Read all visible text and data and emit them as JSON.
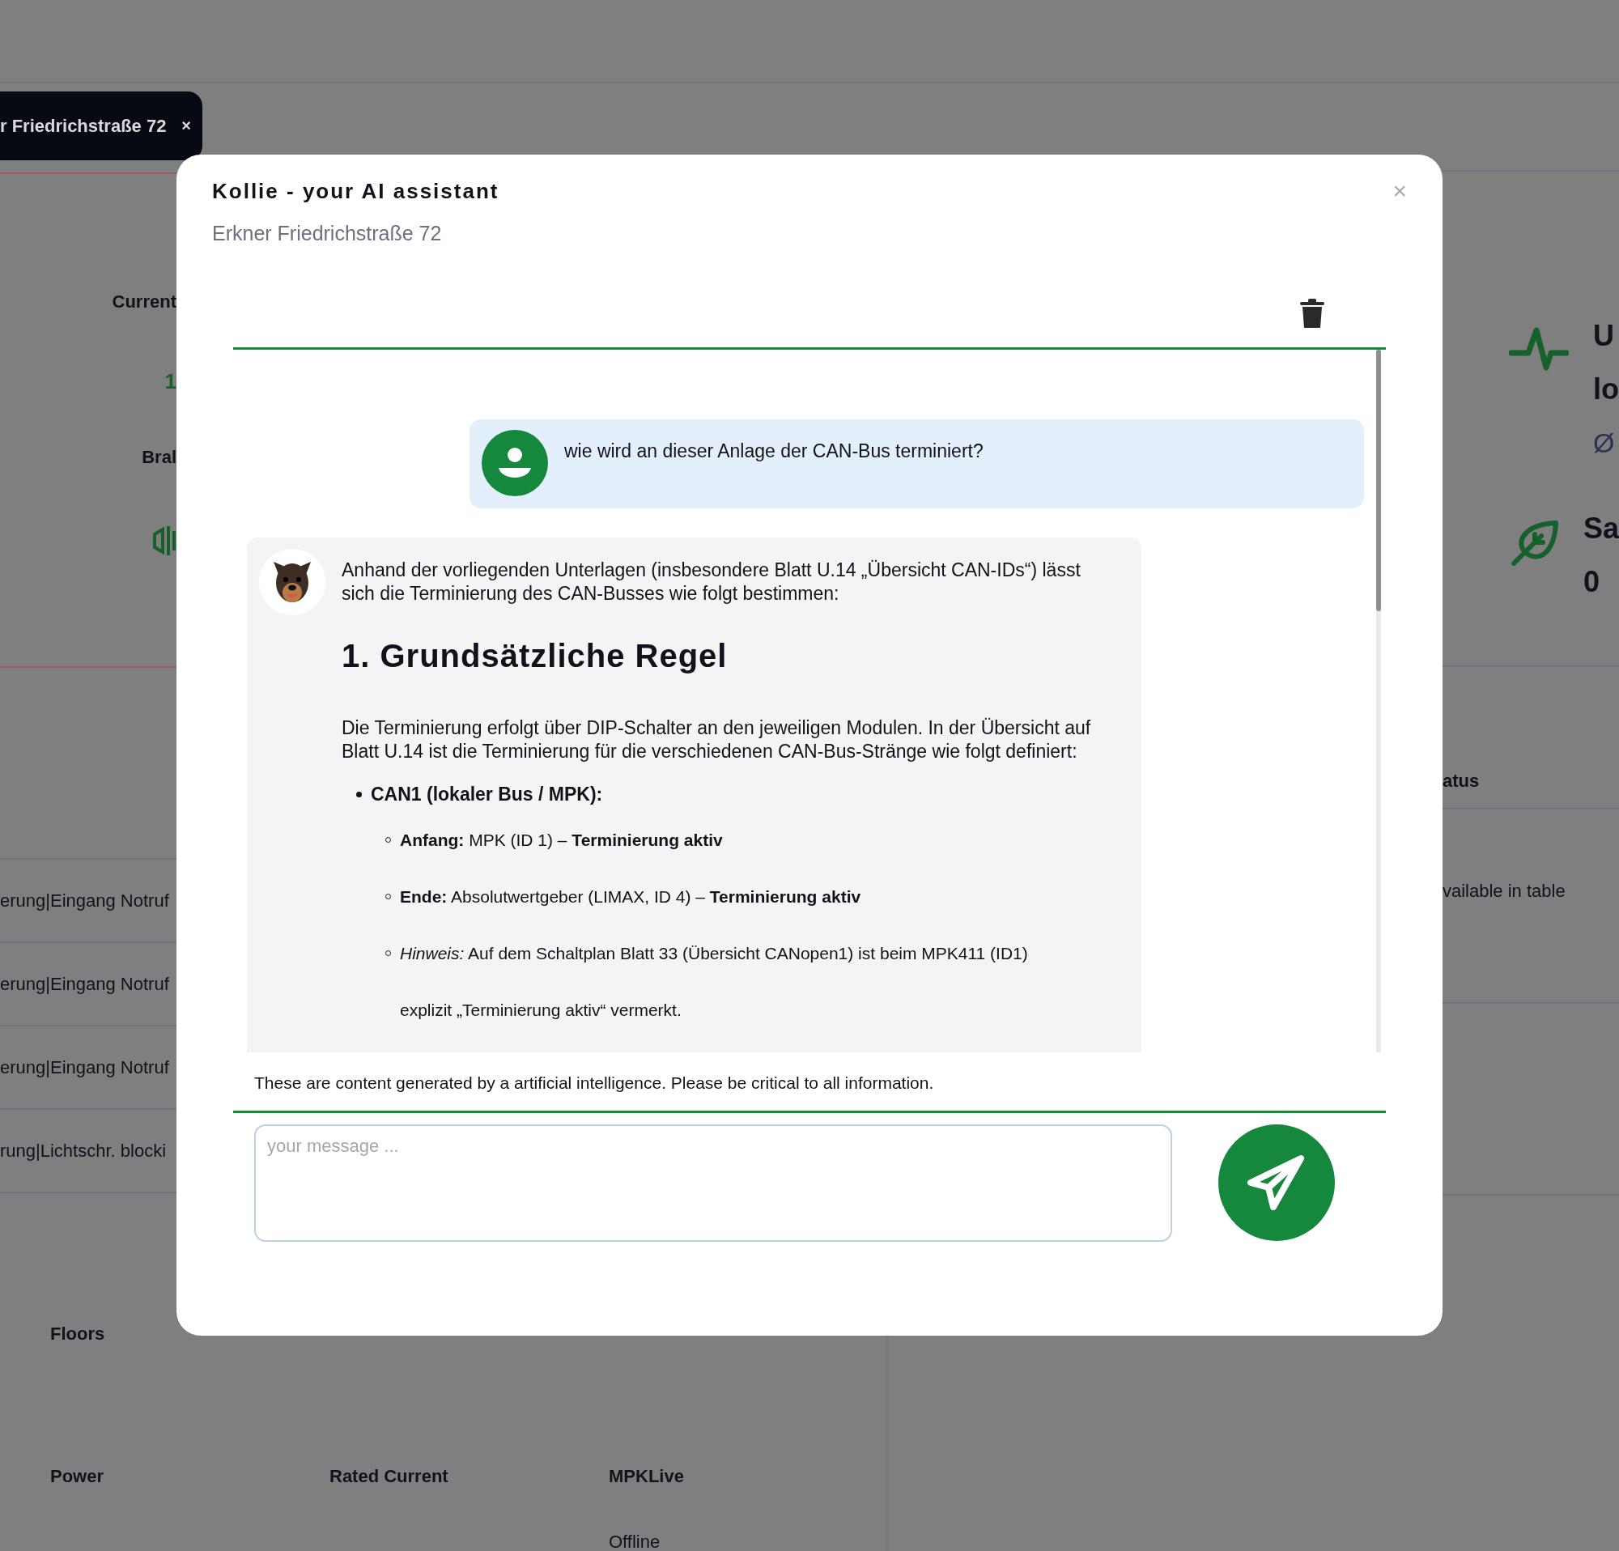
{
  "background": {
    "tab": {
      "label": "r Friedrichstraße 72",
      "close": "×"
    },
    "left_stats": [
      {
        "kind": "value",
        "label": "Current",
        "value": "1"
      },
      {
        "kind": "icon",
        "label": "Bral"
      }
    ],
    "event_rows": [
      "erung|Eingang Notruf",
      "erung|Eingang Notruf",
      "erung|Eingang Notruf",
      "rung|Lichtschr. blocki"
    ],
    "right_stats": [
      {
        "kind": "activity",
        "lines": [
          "U",
          "lo"
        ],
        "sub": "Ø"
      },
      {
        "kind": "leaf",
        "lines": [
          "Sa",
          "0"
        ]
      }
    ],
    "status_table": {
      "heading": "atus",
      "empty_text": "vailable in table"
    },
    "field_rows": [
      [
        {
          "label": "Floors"
        }
      ],
      [
        {
          "label": "Power"
        },
        {
          "label": "Rated Current"
        },
        {
          "label": "MPKLive",
          "value": "Offline"
        }
      ]
    ]
  },
  "dialog": {
    "title": "Kollie - your AI assistant",
    "subtitle": "Erkner Friedrichstraße 72",
    "close": "×",
    "messages": [
      {
        "kind": "user",
        "text": "wie wird an dieser Anlage der CAN-Bus terminiert?"
      },
      {
        "kind": "assistant",
        "blocks": [
          {
            "kind": "paragraph",
            "text": "Anhand der vorliegenden Unterlagen (insbesondere Blatt U.14 „Übersicht CAN-IDs“) lässt sich die Terminierung des CAN-Busses wie folgt bestimmen:"
          },
          {
            "kind": "heading",
            "text": "1. Grundsätzliche Regel"
          },
          {
            "kind": "paragraph",
            "text": "Die Terminierung erfolgt über DIP-Schalter an den jeweiligen Modulen. In der Übersicht auf Blatt U.14 ist die Terminierung für die verschiedenen CAN-Bus-Stränge wie folgt definiert:"
          },
          {
            "kind": "list",
            "items": [
              {
                "text": "CAN1 (lokaler Bus / MPK):",
                "children": [
                  {
                    "lines": [
                      "**Anfang:** MPK (ID 1) – **Terminierung aktiv**"
                    ]
                  },
                  {
                    "lines": [
                      "**Ende:** Absolutwertgeber (LIMAX, ID 4) – **Terminierung aktiv**"
                    ]
                  },
                  {
                    "lines": [
                      "*Hinweis:* Auf dem Schaltplan Blatt 33 (Übersicht CANopen1) ist beim MPK411 (ID1)",
                      "explizit „Terminierung aktiv“ vermerkt."
                    ]
                  }
                ]
              }
            ]
          }
        ]
      }
    ],
    "disclaimer": "These are content generated by a artificial intelligence. Please be critical to all information.",
    "input": {
      "placeholder": "your message ..."
    }
  }
}
